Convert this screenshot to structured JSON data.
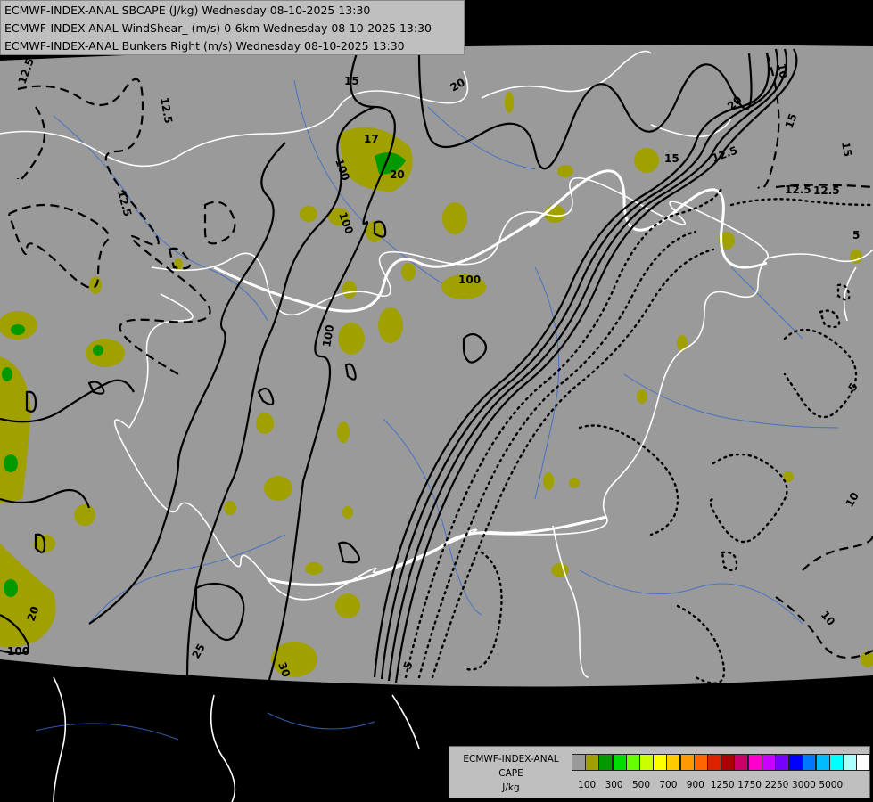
{
  "header": {
    "lines": [
      "ECMWF-INDEX-ANAL SBCAPE (J/kg) Wednesday 08-10-2025 13:30",
      "ECMWF-INDEX-ANAL WindShear_ (m/s) 0-6km Wednesday 08-10-2025 13:30",
      "ECMWF-INDEX-ANAL Bunkers Right (m/s) Wednesday 08-10-2025 13:30"
    ]
  },
  "legend": {
    "title_lines": [
      "ECMWF-INDEX-ANAL",
      "CAPE",
      "J/kg"
    ],
    "colors": [
      "#9a9a9a",
      "#a0a000",
      "#009900",
      "#00dd00",
      "#66ff00",
      "#ccff00",
      "#ffff00",
      "#ffcc00",
      "#ff9900",
      "#ff6600",
      "#dd2200",
      "#aa0000",
      "#cc0066",
      "#ff00cc",
      "#cc00ff",
      "#7700ff",
      "#0000ff",
      "#0077ff",
      "#00bbff",
      "#00ffff",
      "#aaffff",
      "#ffffff"
    ],
    "tick_labels": [
      "100",
      "300",
      "500",
      "700",
      "900",
      "1250",
      "1750",
      "2250",
      "3000",
      "5000"
    ]
  },
  "contour_labels": [
    "12.5",
    "12.5",
    "12.5",
    "12.5",
    "15",
    "15",
    "17",
    "20",
    "20",
    "20",
    "100",
    "100",
    "100",
    "100",
    "15",
    "12.5",
    "10",
    "15",
    "12.5",
    "5",
    "5",
    "10",
    "10",
    "25",
    "30",
    "5",
    "20",
    "100"
  ]
}
